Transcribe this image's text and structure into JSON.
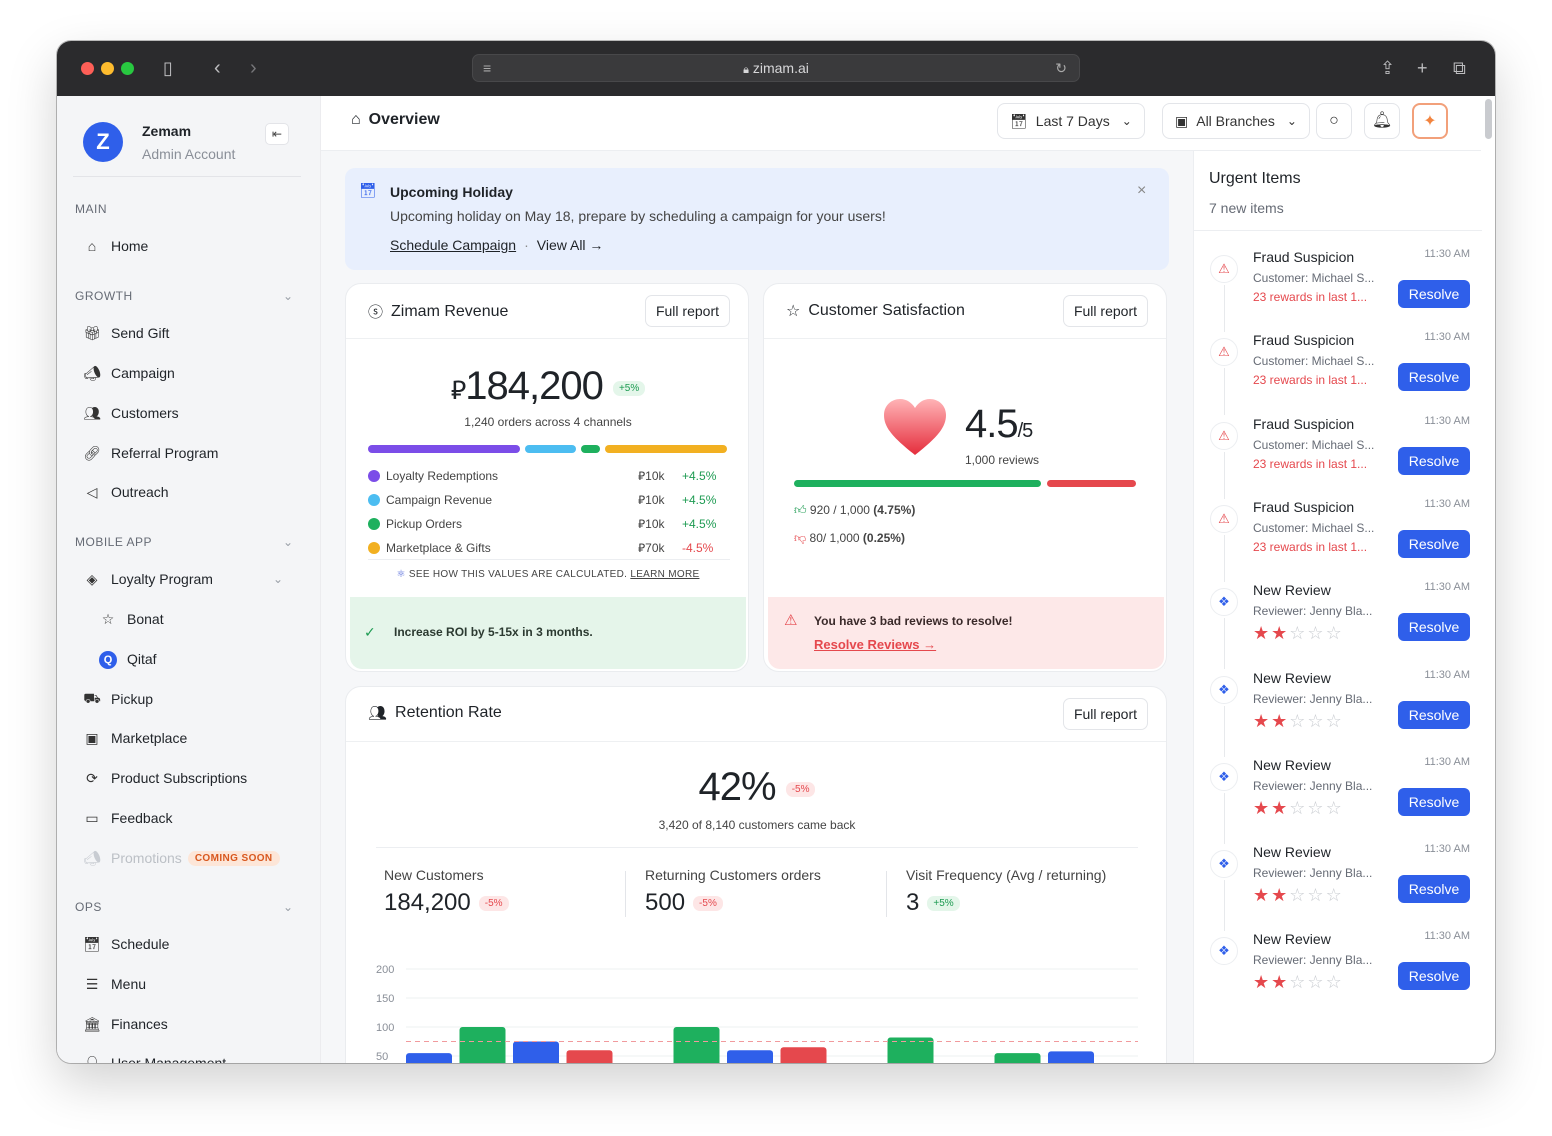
{
  "browser": {
    "url": "zimam.ai"
  },
  "brand": {
    "name": "Zemam",
    "subtitle": "Admin Account",
    "logo_letter": "Z",
    "accent": "#2f5fea"
  },
  "sidebar": {
    "main_title": "MAIN",
    "home": "Home",
    "growth_title": "GROWTH",
    "growth": [
      "Send Gift",
      "Campaign",
      "Customers",
      "Referral Program",
      "Outreach"
    ],
    "mobile_title": "MOBILE APP",
    "loyalty": "Loyalty Program",
    "loyalty_sub": [
      "Bonat",
      "Qitaf"
    ],
    "mobile": [
      "Pickup",
      "Marketplace",
      "Product Subscriptions",
      "Feedback"
    ],
    "promotions": "Promotions",
    "coming_soon": "COMING SOON",
    "ops_title": "OPS",
    "ops": [
      "Schedule",
      "Menu",
      "Finances",
      "User Management"
    ]
  },
  "topbar": {
    "title": "Overview",
    "date_range": "Last 7 Days",
    "branches": "All Branches"
  },
  "banner": {
    "title": "Upcoming Holiday",
    "text": "Upcoming holiday on May 18, prepare by scheduling a campaign for your users!",
    "link1": "Schedule Campaign",
    "sep": "·",
    "link2": "View All →"
  },
  "revenue": {
    "title": "Zimam Revenue",
    "full_report": "Full report",
    "currency": "⃁",
    "amount": "184,200",
    "change": "+5%",
    "sub": "1,240 orders across 4 channels",
    "rows": [
      {
        "label": "Loyalty Redemptions",
        "value": "10k",
        "change": "+4.5%",
        "color": "#7b4de8",
        "positive": true
      },
      {
        "label": "Campaign Revenue",
        "value": "10k",
        "change": "+4.5%",
        "color": "#4cbdf1",
        "positive": true
      },
      {
        "label": "Pickup Orders",
        "value": "10k",
        "change": "+4.5%",
        "color": "#1eb05e",
        "positive": true
      },
      {
        "label": "Marketplace & Gifts",
        "value": "70k",
        "change": "-4.5%",
        "color": "#f2b021",
        "positive": false
      }
    ],
    "calc_note": "SEE HOW THIS VALUES ARE CALCULATED.",
    "learn_more": "LEARN MORE",
    "footer": "Increase ROI by 5-15x in 3 months."
  },
  "satisfaction": {
    "title": "Customer Satisfaction",
    "full_report": "Full report",
    "score": "4.5",
    "out_of": "/5",
    "reviews": "1,000 reviews",
    "positive_count": "920 / 1,000",
    "positive_pct": "(4.75%)",
    "negative_count": "80/ 1,000",
    "negative_pct": "(0.25%)",
    "positive_share": 0.73,
    "alert": "You have 3 bad reviews to resolve!",
    "alert_link": "Resolve Reviews →"
  },
  "retention": {
    "title": "Retention Rate",
    "full_report": "Full report",
    "rate": "42%",
    "change": "-5%",
    "sub": "3,420 of 8,140 customers came back",
    "stats": [
      {
        "label": "New Customers",
        "value": "184,200",
        "change": "-5%",
        "positive": false
      },
      {
        "label": "Returning Customers orders",
        "value": "500",
        "change": "-5%",
        "positive": false
      },
      {
        "label": "Visit Frequency (Avg / returning)",
        "value": "3",
        "change": "+5%",
        "positive": true
      }
    ]
  },
  "chart_data": {
    "type": "bar",
    "y_ticks": [
      "200",
      "150",
      "100",
      "50"
    ],
    "ylim": [
      0,
      200
    ],
    "reference_line": 75,
    "bars": [
      {
        "x": 0,
        "value": 55,
        "color": "#2f5fea"
      },
      {
        "x": 1,
        "value": 100,
        "color": "#1eb05e"
      },
      {
        "x": 2,
        "value": 75,
        "color": "#2f5fea"
      },
      {
        "x": 3,
        "value": 60,
        "color": "#e5484d"
      },
      {
        "x": 5,
        "value": 100,
        "color": "#1eb05e"
      },
      {
        "x": 6,
        "value": 60,
        "color": "#2f5fea"
      },
      {
        "x": 7,
        "value": 65,
        "color": "#e5484d"
      },
      {
        "x": 9,
        "value": 82,
        "color": "#1eb05e"
      },
      {
        "x": 11,
        "value": 55,
        "color": "#1eb05e"
      },
      {
        "x": 12,
        "value": 58,
        "color": "#2f5fea"
      }
    ]
  },
  "urgent": {
    "title": "Urgent Items",
    "count": "7 new items",
    "resolve_label": "Resolve",
    "items": [
      {
        "kind": "fraud",
        "title": "Fraud Suspicion",
        "sub": "Customer: Michael S...",
        "warn": "23 rewards in last 1...",
        "time": "11:30 AM"
      },
      {
        "kind": "fraud",
        "title": "Fraud Suspicion",
        "sub": "Customer: Michael S...",
        "warn": "23 rewards in last 1...",
        "time": "11:30 AM"
      },
      {
        "kind": "fraud",
        "title": "Fraud Suspicion",
        "sub": "Customer: Michael S...",
        "warn": "23 rewards in last 1...",
        "time": "11:30 AM"
      },
      {
        "kind": "fraud",
        "title": "Fraud Suspicion",
        "sub": "Customer: Michael S...",
        "warn": "23 rewards in last 1...",
        "time": "11:30 AM"
      },
      {
        "kind": "review",
        "title": "New Review",
        "sub": "Reviewer: Jenny Bla...",
        "rating": 2,
        "time": "11:30 AM"
      },
      {
        "kind": "review",
        "title": "New Review",
        "sub": "Reviewer: Jenny Bla...",
        "rating": 2,
        "time": "11:30 AM"
      },
      {
        "kind": "review",
        "title": "New Review",
        "sub": "Reviewer: Jenny Bla...",
        "rating": 2,
        "time": "11:30 AM"
      },
      {
        "kind": "review",
        "title": "New Review",
        "sub": "Reviewer: Jenny Bla...",
        "rating": 2,
        "time": "11:30 AM"
      },
      {
        "kind": "review",
        "title": "New Review",
        "sub": "Reviewer: Jenny Bla...",
        "rating": 2,
        "time": "11:30 AM"
      }
    ]
  }
}
